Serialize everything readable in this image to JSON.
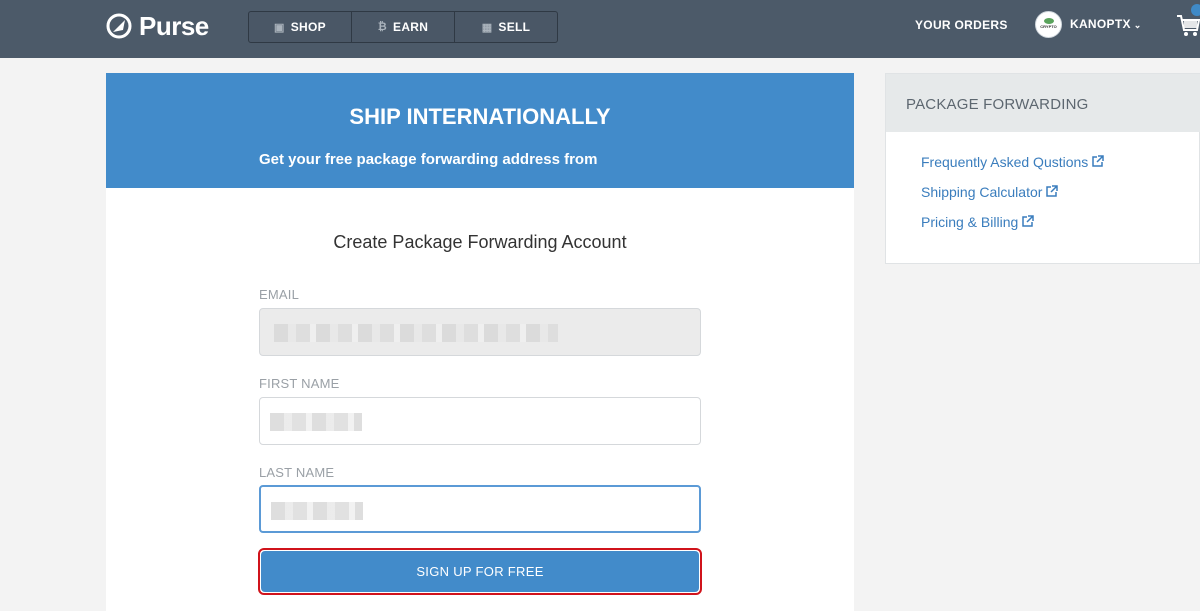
{
  "nav": {
    "brand": "Purse",
    "tabs": [
      {
        "label": "SHOP",
        "icon": "gift-icon"
      },
      {
        "label": "EARN",
        "icon": "bitcoin-icon"
      },
      {
        "label": "SELL",
        "icon": "calculator-icon"
      }
    ],
    "your_orders": "YOUR ORDERS",
    "avatar_text": "CRYPTO",
    "username": "KANOPTX"
  },
  "hero": {
    "title": "SHIP INTERNATIONALLY",
    "subtitle": "Get your free package forwarding address from"
  },
  "form": {
    "title": "Create Package Forwarding Account",
    "email_label": "EMAIL",
    "first_name_label": "FIRST NAME",
    "last_name_label": "LAST NAME",
    "submit_label": "SIGN UP FOR FREE"
  },
  "sidebar": {
    "title": "PACKAGE FORWARDING",
    "links": [
      "Frequently Asked Qustions",
      "Shipping Calculator",
      "Pricing & Billing"
    ]
  },
  "colors": {
    "topbar": "#4c5a69",
    "accent": "#428bca",
    "highlight_outline": "#d0131b",
    "link": "#3a7dbd"
  }
}
